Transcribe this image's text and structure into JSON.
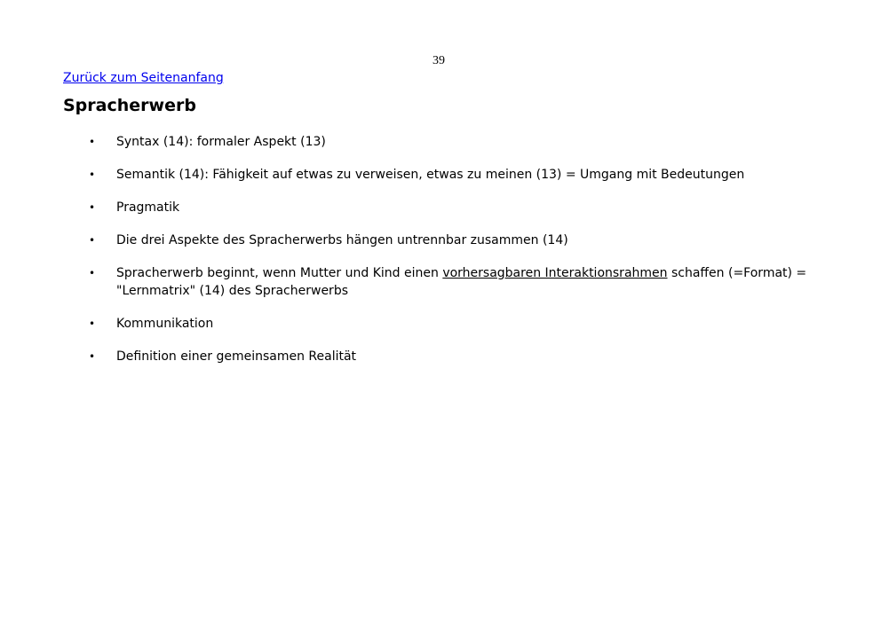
{
  "page_number": "39",
  "back_link": "Zurück zum Seitenanfang",
  "heading": "Spracherwerb",
  "bullet_symbol": "•",
  "items": [
    {
      "text": "Syntax (14): formaler Aspekt (13)"
    },
    {
      "text": "Semantik (14): Fähigkeit auf etwas zu verweisen, etwas zu meinen (13) = Umgang mit Bedeutungen"
    },
    {
      "text": "Pragmatik"
    },
    {
      "text": "Die drei Aspekte des Spracherwerbs hängen untrennbar zusammen (14)"
    },
    {
      "before": "Spracherwerb beginnt, wenn Mutter und Kind einen ",
      "underlined": "vorhersagbaren Interaktionsrahmen",
      "after": " schaffen (=Format) = \"Lernmatrix\" (14) des Spracherwerbs"
    },
    {
      "text": "Kommunikation"
    },
    {
      "text": "Definition einer gemeinsamen Realität"
    }
  ]
}
